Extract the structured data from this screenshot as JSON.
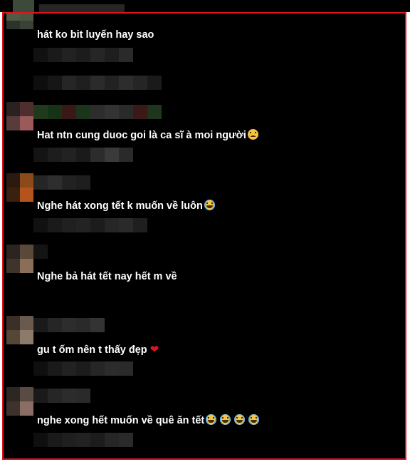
{
  "comments": [
    {
      "text": "hát ko bit luyến hay sao",
      "emojis": []
    },
    {
      "text": "Hat ntn cung duoc goi là ca sĩ à moi người",
      "emojis": [
        "sad-face"
      ]
    },
    {
      "text": "Nghe hát xong tết k muốn về luôn",
      "emojis": [
        "laughing-face"
      ]
    },
    {
      "text": "Nghe bả hát tết nay hết m về",
      "emojis": []
    },
    {
      "text": "gu t ốm nên t thấy đẹp",
      "emojis": [
        "red-heart"
      ]
    },
    {
      "text": "nghe xong hết muốn về quê ăn tết",
      "emojis": [
        "laughing-face",
        "laughing-face",
        "laughing-face",
        "laughing-face"
      ]
    }
  ],
  "colors": {
    "highlight_border": "#e0141e",
    "background": "#000000",
    "text": "#ffffff"
  }
}
